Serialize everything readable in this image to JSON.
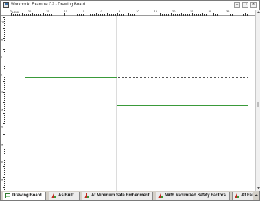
{
  "window": {
    "title": "Workbook: Example C2 - Drawing Board",
    "minimize_symbol": "–",
    "maximize_symbol": "□",
    "close_symbol": "×",
    "icon": "drawing-board-app-icon"
  },
  "rulers": {
    "zoom": "1:250",
    "horizontal_labels": [
      "-25",
      "-20",
      "-15",
      "-10",
      "-5",
      "0",
      "5",
      "10",
      "15",
      "20",
      "25",
      "30",
      "35"
    ],
    "vertical_labels": [
      "-10",
      "-5",
      "0",
      "5",
      "10",
      "15",
      "20",
      "25",
      "30",
      "35"
    ]
  },
  "tabs": [
    {
      "label": "Drawing Board",
      "icon": "drawing-board-icon",
      "active": true
    },
    {
      "label": "As Built",
      "icon": "wall-section-icon",
      "active": false
    },
    {
      "label": "At Minimum Safe Embedment",
      "icon": "wall-section-icon",
      "active": false
    },
    {
      "label": "With Maximized Safety Factors",
      "icon": "wall-section-icon",
      "active": false
    },
    {
      "label": "At Fai",
      "icon": "wall-section-icon",
      "active": false
    }
  ],
  "colors": {
    "ground_line": "#3a9a3a",
    "dotted_line": "#555555",
    "wall_line": "#b8b8b8"
  }
}
